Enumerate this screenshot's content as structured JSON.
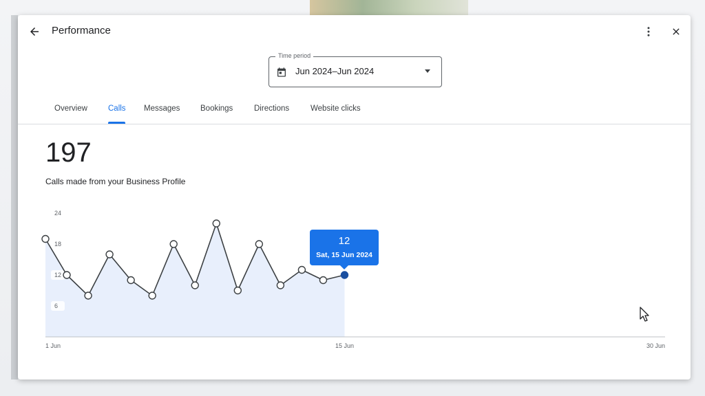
{
  "header": {
    "title": "Performance",
    "back_icon": "arrow-back-icon",
    "more_icon": "more-vert-icon",
    "close_icon": "close-icon"
  },
  "time_period": {
    "label": "Time period",
    "value": "Jun 2024–Jun 2024",
    "icon": "calendar-icon"
  },
  "tabs": [
    {
      "label": "Overview",
      "active": false
    },
    {
      "label": "Calls",
      "active": true
    },
    {
      "label": "Messages",
      "active": false
    },
    {
      "label": "Bookings",
      "active": false
    },
    {
      "label": "Directions",
      "active": false
    },
    {
      "label": "Website clicks",
      "active": false
    }
  ],
  "summary": {
    "total": "197",
    "caption": "Calls made from your Business Profile"
  },
  "tooltip": {
    "value": "12",
    "date": "Sat, 15 Jun 2024"
  },
  "colors": {
    "accent": "#1a73e8",
    "line": "#3c4043",
    "area": "#e8effc",
    "highlight_point": "#1a4fa0"
  },
  "chart_data": {
    "type": "area",
    "title": "",
    "xlabel": "",
    "ylabel": "",
    "x_ticks": [
      "1 Jun",
      "15 Jun",
      "30 Jun"
    ],
    "y_ticks": [
      6,
      12,
      18,
      24
    ],
    "xlim": [
      1,
      30
    ],
    "ylim": [
      0,
      24
    ],
    "grid": false,
    "series": [
      {
        "x": [
          1,
          2,
          3,
          4,
          5,
          6,
          7,
          8,
          9,
          10,
          11,
          12,
          13,
          14,
          15
        ],
        "y": [
          19,
          12,
          8,
          16,
          11,
          8,
          18,
          10,
          22,
          9,
          18,
          10,
          13,
          11,
          12
        ]
      }
    ],
    "highlighted": {
      "x": 15,
      "y": 12
    }
  }
}
